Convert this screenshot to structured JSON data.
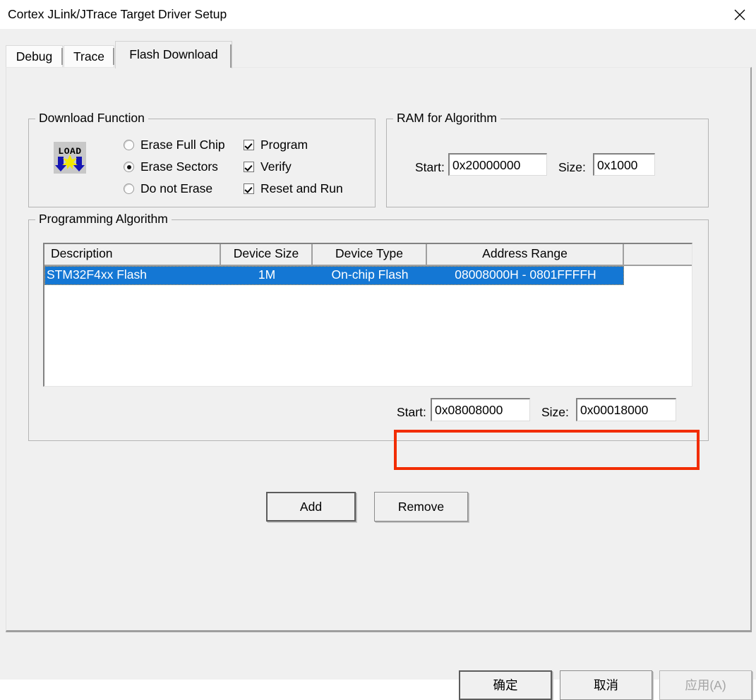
{
  "window": {
    "title": "Cortex JLink/JTrace Target Driver Setup",
    "close_icon": "close-icon"
  },
  "tabs": [
    {
      "label": "Debug",
      "active": false
    },
    {
      "label": "Trace",
      "active": false
    },
    {
      "label": "Flash Download",
      "active": true
    }
  ],
  "download_function": {
    "title": "Download Function",
    "icon": "load-icon",
    "icon_text": "LOAD",
    "radios": [
      {
        "label": "Erase Full Chip",
        "checked": false
      },
      {
        "label": "Erase Sectors",
        "checked": true
      },
      {
        "label": "Do not Erase",
        "checked": false
      }
    ],
    "checkboxes": [
      {
        "label": "Program",
        "checked": true
      },
      {
        "label": "Verify",
        "checked": true
      },
      {
        "label": "Reset and Run",
        "checked": true
      }
    ]
  },
  "ram_for_algorithm": {
    "title": "RAM for Algorithm",
    "start_label": "Start:",
    "start_value": "0x20000000",
    "size_label": "Size:",
    "size_value": "0x1000"
  },
  "programming_algorithm": {
    "title": "Programming Algorithm",
    "columns": [
      "Description",
      "Device Size",
      "Device Type",
      "Address Range",
      ""
    ],
    "rows": [
      {
        "description": "STM32F4xx Flash",
        "device_size": "1M",
        "device_type": "On-chip Flash",
        "address_range": "08008000H - 0801FFFFH",
        "selected": true
      }
    ],
    "start_label": "Start:",
    "start_value": "0x08008000",
    "size_label": "Size:",
    "size_value": "0x00018000",
    "highlight_color": "#f22d00",
    "selection_color": "#1477d4"
  },
  "buttons": {
    "add": "Add",
    "remove": "Remove",
    "ok": "确定",
    "cancel": "取消",
    "apply": "应用(A)"
  }
}
